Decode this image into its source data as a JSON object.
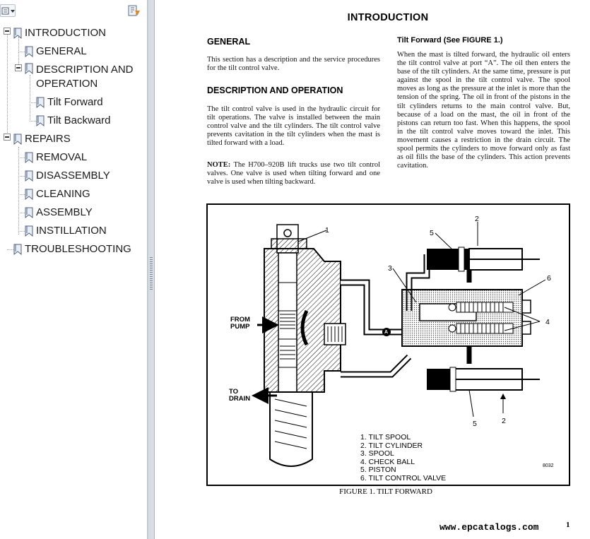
{
  "bookmarks": {
    "items": [
      {
        "label": "INTRODUCTION",
        "level": 0,
        "expandable": true
      },
      {
        "label": "GENERAL",
        "level": 1,
        "expandable": false
      },
      {
        "label": "DESCRIPTION AND",
        "label2": "OPERATION",
        "level": 1,
        "expandable": true
      },
      {
        "label": "Tilt Forward",
        "level": 2,
        "expandable": false
      },
      {
        "label": "Tilt Backward",
        "level": 2,
        "expandable": false
      },
      {
        "label": "REPAIRS",
        "level": 0,
        "expandable": true
      },
      {
        "label": "REMOVAL",
        "level": 1,
        "expandable": false
      },
      {
        "label": "DISASSEMBLY",
        "level": 1,
        "expandable": false
      },
      {
        "label": "CLEANING",
        "level": 1,
        "expandable": false
      },
      {
        "label": "ASSEMBLY",
        "level": 1,
        "expandable": false
      },
      {
        "label": "INSTILLATION",
        "level": 1,
        "expandable": false
      },
      {
        "label": "TROUBLESHOOTING",
        "level": 0,
        "expandable": false
      }
    ]
  },
  "document": {
    "title": "INTRODUCTION",
    "general_heading": "GENERAL",
    "general_text": "This section has a description and the service procedures for the tilt control valve.",
    "desc_heading": "DESCRIPTION AND OPERATION",
    "desc_text": "The tilt control valve is used in the hydraulic circuit for tilt operations. The valve is installed between the main control valve and the tilt cylinders. The tilt control valve prevents cavitation in the tilt cylinders when the mast is tilted forward with a load.",
    "note_label": "NOTE:",
    "note_text": " The H700–920B lift trucks use two tilt control valves. One valve is used when tilting forward and one valve is used  when tilting backward.",
    "tilt_heading": "Tilt Forward  (See FIGURE 1.)",
    "tilt_text": "When the mast is tilted forward, the hydraulic oil enters the tilt control valve at port “A”. The oil then enters the base of the tilt cylinders. At the same time, pressure is put against the spool in the tilt control valve. The spool moves as long as the pressure at the inlet is more than the tension of the spring. The oil in front of the pistons in the tilt cylinders returns to the main control valve. But, because of a load on the mast, the oil in front of the pistons can return too fast. When this happens, the spool in the tilt control valve moves toward the inlet. This movement causes a restriction in the drain circuit. The spool permits the cylinders to move forward only as fast as oil fills the base of the cylinders. This action prevents cavitation.",
    "figure": {
      "label_pump": "FROM\nPUMP",
      "label_drain": "TO\nDRAIN",
      "port_label": "A",
      "callouts": [
        "1",
        "2",
        "3",
        "4",
        "5",
        "6",
        "5",
        "2"
      ],
      "legend": [
        "1. TILT SPOOL",
        "2. TILT CYLINDER",
        "3. SPOOL",
        "4. CHECK BALL",
        "5. PISTON",
        "6. TILT CONTROL VALVE"
      ],
      "figure_number": "8032",
      "caption": "FIGURE 1. TILT FORWARD"
    },
    "website": "www.epcatalogs.com",
    "page_number": "1"
  }
}
